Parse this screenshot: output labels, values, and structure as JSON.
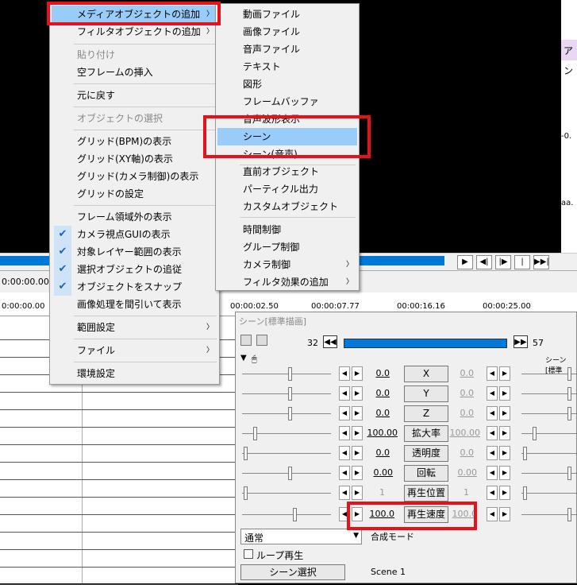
{
  "playback": {
    "buttons": [
      "▶",
      "◀|",
      "|▶",
      "|◀◀",
      "▶▶|"
    ]
  },
  "infobar": {
    "time": "0:00:00.00]",
    "frame": "[1"
  },
  "ruler": {
    "start": "0:00:00.00",
    "t1": "00:00:02.50",
    "t2": "00:00:07.77",
    "t3": "00:00:16.16",
    "t4": "00:00:25.00"
  },
  "side_panel": {
    "a": "ア",
    "b": "ン",
    "c": "-0.",
    "d": "aa."
  },
  "context_menu": {
    "items": [
      {
        "label": "メディアオブジェクトの追加",
        "submenu": true,
        "highlight": true
      },
      {
        "label": "フィルタオブジェクトの追加",
        "submenu": true
      },
      {
        "label": "貼り付け",
        "disabled": true
      },
      {
        "label": "空フレームの挿入"
      },
      {
        "label": "元に戻す"
      },
      {
        "label": "オブジェクトの選択",
        "disabled": true
      },
      {
        "label": "グリッド(BPM)の表示"
      },
      {
        "label": "グリッド(XY軸)の表示"
      },
      {
        "label": "グリッド(カメラ制御)の表示"
      },
      {
        "label": "グリッドの設定"
      },
      {
        "label": "フレーム領域外の表示"
      },
      {
        "label": "カメラ視点GUIの表示",
        "checked": true
      },
      {
        "label": "対象レイヤー範囲の表示",
        "checked": true
      },
      {
        "label": "選択オブジェクトの追従",
        "checked": true
      },
      {
        "label": "オブジェクトをスナップ",
        "checked": true
      },
      {
        "label": "画像処理を間引いて表示"
      },
      {
        "label": "範囲設定",
        "submenu": true
      },
      {
        "label": "ファイル",
        "submenu": true
      },
      {
        "label": "環境設定"
      }
    ]
  },
  "media_submenu": {
    "items": [
      {
        "label": "動画ファイル"
      },
      {
        "label": "画像ファイル"
      },
      {
        "label": "音声ファイル"
      },
      {
        "label": "テキスト"
      },
      {
        "label": "図形"
      },
      {
        "label": "フレームバッファ"
      },
      {
        "label": "音声波形表示"
      },
      {
        "label": "シーン",
        "highlight": true
      },
      {
        "label": "シーン(音声)"
      },
      {
        "label": "直前オブジェクト"
      },
      {
        "label": "パーティクル出力"
      },
      {
        "label": "カスタムオブジェクト"
      },
      {
        "label": "時間制御"
      },
      {
        "label": "グループ制御"
      },
      {
        "label": "カメラ制御",
        "submenu": true
      },
      {
        "label": "フィルタ効果の追加",
        "submenu": true
      }
    ]
  },
  "properties": {
    "title": "シーン[標準描画]",
    "frame_start": "32",
    "frame_end": "57",
    "right_header": "シーン[標準",
    "rows": [
      {
        "left": "0.0",
        "label": "X",
        "right": "0.0"
      },
      {
        "left": "0.0",
        "label": "Y",
        "right": "0.0"
      },
      {
        "left": "0.0",
        "label": "Z",
        "right": "0.0"
      },
      {
        "left": "100.00",
        "label": "拡大率",
        "right": "100.00"
      },
      {
        "left": "0.0",
        "label": "透明度",
        "right": "0.0"
      },
      {
        "left": "0.00",
        "label": "回転",
        "right": "0.00"
      },
      {
        "left": "1",
        "label": "再生位置",
        "right": "1",
        "left_disabled": true
      },
      {
        "left": "100.0",
        "label": "再生速度",
        "right": "100.0"
      }
    ],
    "blend_mode": "通常",
    "blend_mode_label": "合成モード",
    "loop_label": "ループ再生",
    "scene_select_label": "シーン選択",
    "scene_value": "Scene 1"
  },
  "highlight_color": "#99ccf8",
  "annotation_color": "#e8101a"
}
